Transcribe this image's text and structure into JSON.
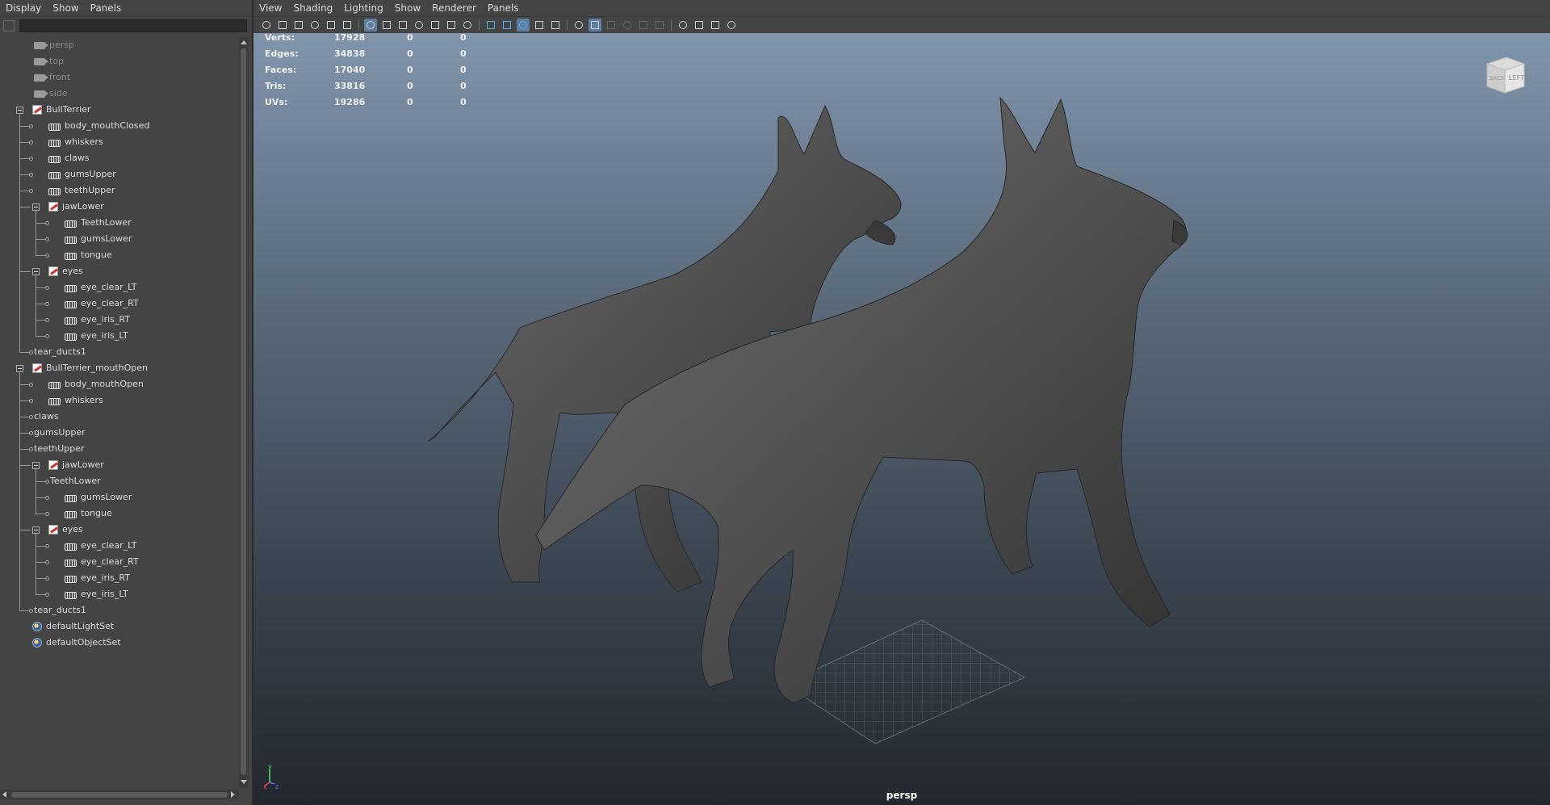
{
  "outliner": {
    "menu": [
      "Display",
      "Show",
      "Panels"
    ],
    "filter_value": "",
    "items": [
      {
        "label": "persp",
        "type": "camera",
        "depth": 1,
        "dim": true
      },
      {
        "label": "top",
        "type": "camera",
        "depth": 1,
        "dim": true
      },
      {
        "label": "front",
        "type": "camera",
        "depth": 1,
        "dim": true
      },
      {
        "label": "side",
        "type": "camera",
        "depth": 1,
        "dim": true
      },
      {
        "label": "BullTerrier",
        "type": "group",
        "depth": 0,
        "expanded": true
      },
      {
        "label": "body_mouthClosed",
        "type": "mesh",
        "depth": 1
      },
      {
        "label": "whiskers",
        "type": "mesh",
        "depth": 1
      },
      {
        "label": "claws",
        "type": "mesh",
        "depth": 1
      },
      {
        "label": "gumsUpper",
        "type": "mesh",
        "depth": 1
      },
      {
        "label": "teethUpper",
        "type": "mesh",
        "depth": 1
      },
      {
        "label": "jawLower",
        "type": "group",
        "depth": 1,
        "expanded": true
      },
      {
        "label": "TeethLower",
        "type": "mesh",
        "depth": 2
      },
      {
        "label": "gumsLower",
        "type": "mesh",
        "depth": 2
      },
      {
        "label": "tongue",
        "type": "mesh",
        "depth": 2
      },
      {
        "label": "eyes",
        "type": "group",
        "depth": 1,
        "expanded": true
      },
      {
        "label": "eye_clear_LT",
        "type": "mesh",
        "depth": 2
      },
      {
        "label": "eye_clear_RT",
        "type": "mesh",
        "depth": 2
      },
      {
        "label": "eye_iris_RT",
        "type": "mesh",
        "depth": 2
      },
      {
        "label": "eye_iris_LT",
        "type": "mesh",
        "depth": 2
      },
      {
        "label": "tear_ducts1",
        "type": "none",
        "depth": 1
      },
      {
        "label": "BullTerrier_mouthOpen",
        "type": "group",
        "depth": 0,
        "expanded": true
      },
      {
        "label": "body_mouthOpen",
        "type": "mesh",
        "depth": 1
      },
      {
        "label": "whiskers",
        "type": "mesh",
        "depth": 1
      },
      {
        "label": "claws",
        "type": "none",
        "depth": 1
      },
      {
        "label": "gumsUpper",
        "type": "none",
        "depth": 1
      },
      {
        "label": "teethUpper",
        "type": "none",
        "depth": 1
      },
      {
        "label": "jawLower",
        "type": "group",
        "depth": 1,
        "expanded": true
      },
      {
        "label": "TeethLower",
        "type": "none",
        "depth": 2
      },
      {
        "label": "gumsLower",
        "type": "mesh",
        "depth": 2
      },
      {
        "label": "tongue",
        "type": "mesh",
        "depth": 2
      },
      {
        "label": "eyes",
        "type": "group",
        "depth": 1,
        "expanded": true
      },
      {
        "label": "eye_clear_LT",
        "type": "mesh",
        "depth": 2
      },
      {
        "label": "eye_clear_RT",
        "type": "mesh",
        "depth": 2
      },
      {
        "label": "eye_iris_RT",
        "type": "mesh",
        "depth": 2
      },
      {
        "label": "eye_iris_LT",
        "type": "mesh",
        "depth": 2
      },
      {
        "label": "tear_ducts1",
        "type": "none",
        "depth": 1
      },
      {
        "label": "defaultLightSet",
        "type": "set",
        "depth": 0
      },
      {
        "label": "defaultObjectSet",
        "type": "set",
        "depth": 0
      }
    ]
  },
  "viewport": {
    "menu": [
      "View",
      "Shading",
      "Lighting",
      "Show",
      "Renderer",
      "Panels"
    ],
    "toolbar_icons": [
      "select-camera-icon",
      "camera-attributes-icon",
      "bookmark-icon",
      "image-plane-icon",
      "2d-pan-icon",
      "grease-pencil-icon",
      "grid-icon",
      "film-gate-icon",
      "resolution-gate-icon",
      "gate-mask-icon",
      "field-chart-icon",
      "safe-action-icon",
      "safe-title-icon",
      "wireframe-icon",
      "smooth-shade-icon",
      "use-default-material-icon",
      "wireframe-on-shaded-icon",
      "textured-icon",
      "use-all-lights-icon",
      "shadows-icon",
      "screen-space-ao-icon",
      "motion-blur-icon",
      "multisample-aa-icon",
      "depth-of-field-icon",
      "isolate-select-icon",
      "xray-icon",
      "xray-joints-icon",
      "xray-components-icon"
    ],
    "hud": {
      "rows": [
        {
          "label": "Verts:",
          "v1": "17928",
          "v2": "0",
          "v3": "0"
        },
        {
          "label": "Edges:",
          "v1": "34838",
          "v2": "0",
          "v3": "0"
        },
        {
          "label": "Faces:",
          "v1": "17040",
          "v2": "0",
          "v3": "0"
        },
        {
          "label": "Tris:",
          "v1": "33816",
          "v2": "0",
          "v3": "0"
        },
        {
          "label": "UVs:",
          "v1": "19286",
          "v2": "0",
          "v3": "0"
        }
      ]
    },
    "viewcube": {
      "face_left": "LEFT",
      "face_back": "BACK"
    },
    "camera_label": "persp",
    "axis": {
      "x": "x",
      "y": "y",
      "z": "z"
    }
  }
}
